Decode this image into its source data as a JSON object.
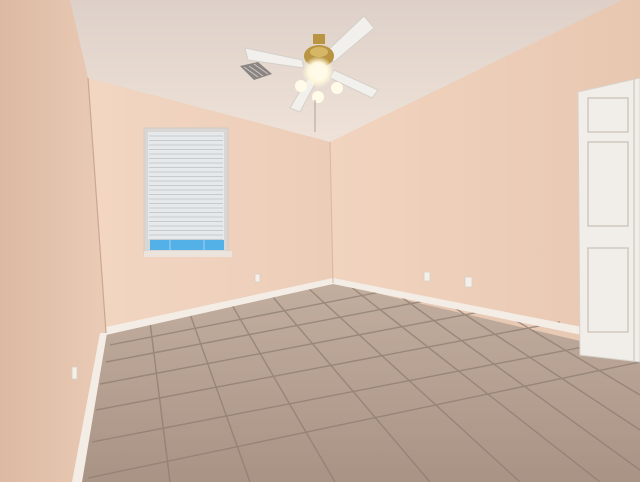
{
  "scene": {
    "kind": "empty-room-photo",
    "colors": {
      "ceiling": "#e7d9d0",
      "left_wall": "#e5c4ae",
      "back_wall": "#f0d3bf",
      "right_wall": "#eed0bb",
      "floor_tile": "#b5a092",
      "grout": "#8f7d71",
      "baseboard": "#f3ede6",
      "door": "#f1eee9",
      "window_glass": "#53b1e8",
      "blinds": "#e6e9ec",
      "fan_blade": "#f2f0ec",
      "fan_brass": "#b99442",
      "light": "#fffbe8"
    },
    "elements": {
      "ceiling_fan": "ceiling-fan-with-light",
      "window": "window-with-blinds",
      "door": "white-panel-door",
      "vent": "ceiling-air-vent",
      "outlets": "wall-outlets",
      "floor": "tile-floor"
    }
  }
}
